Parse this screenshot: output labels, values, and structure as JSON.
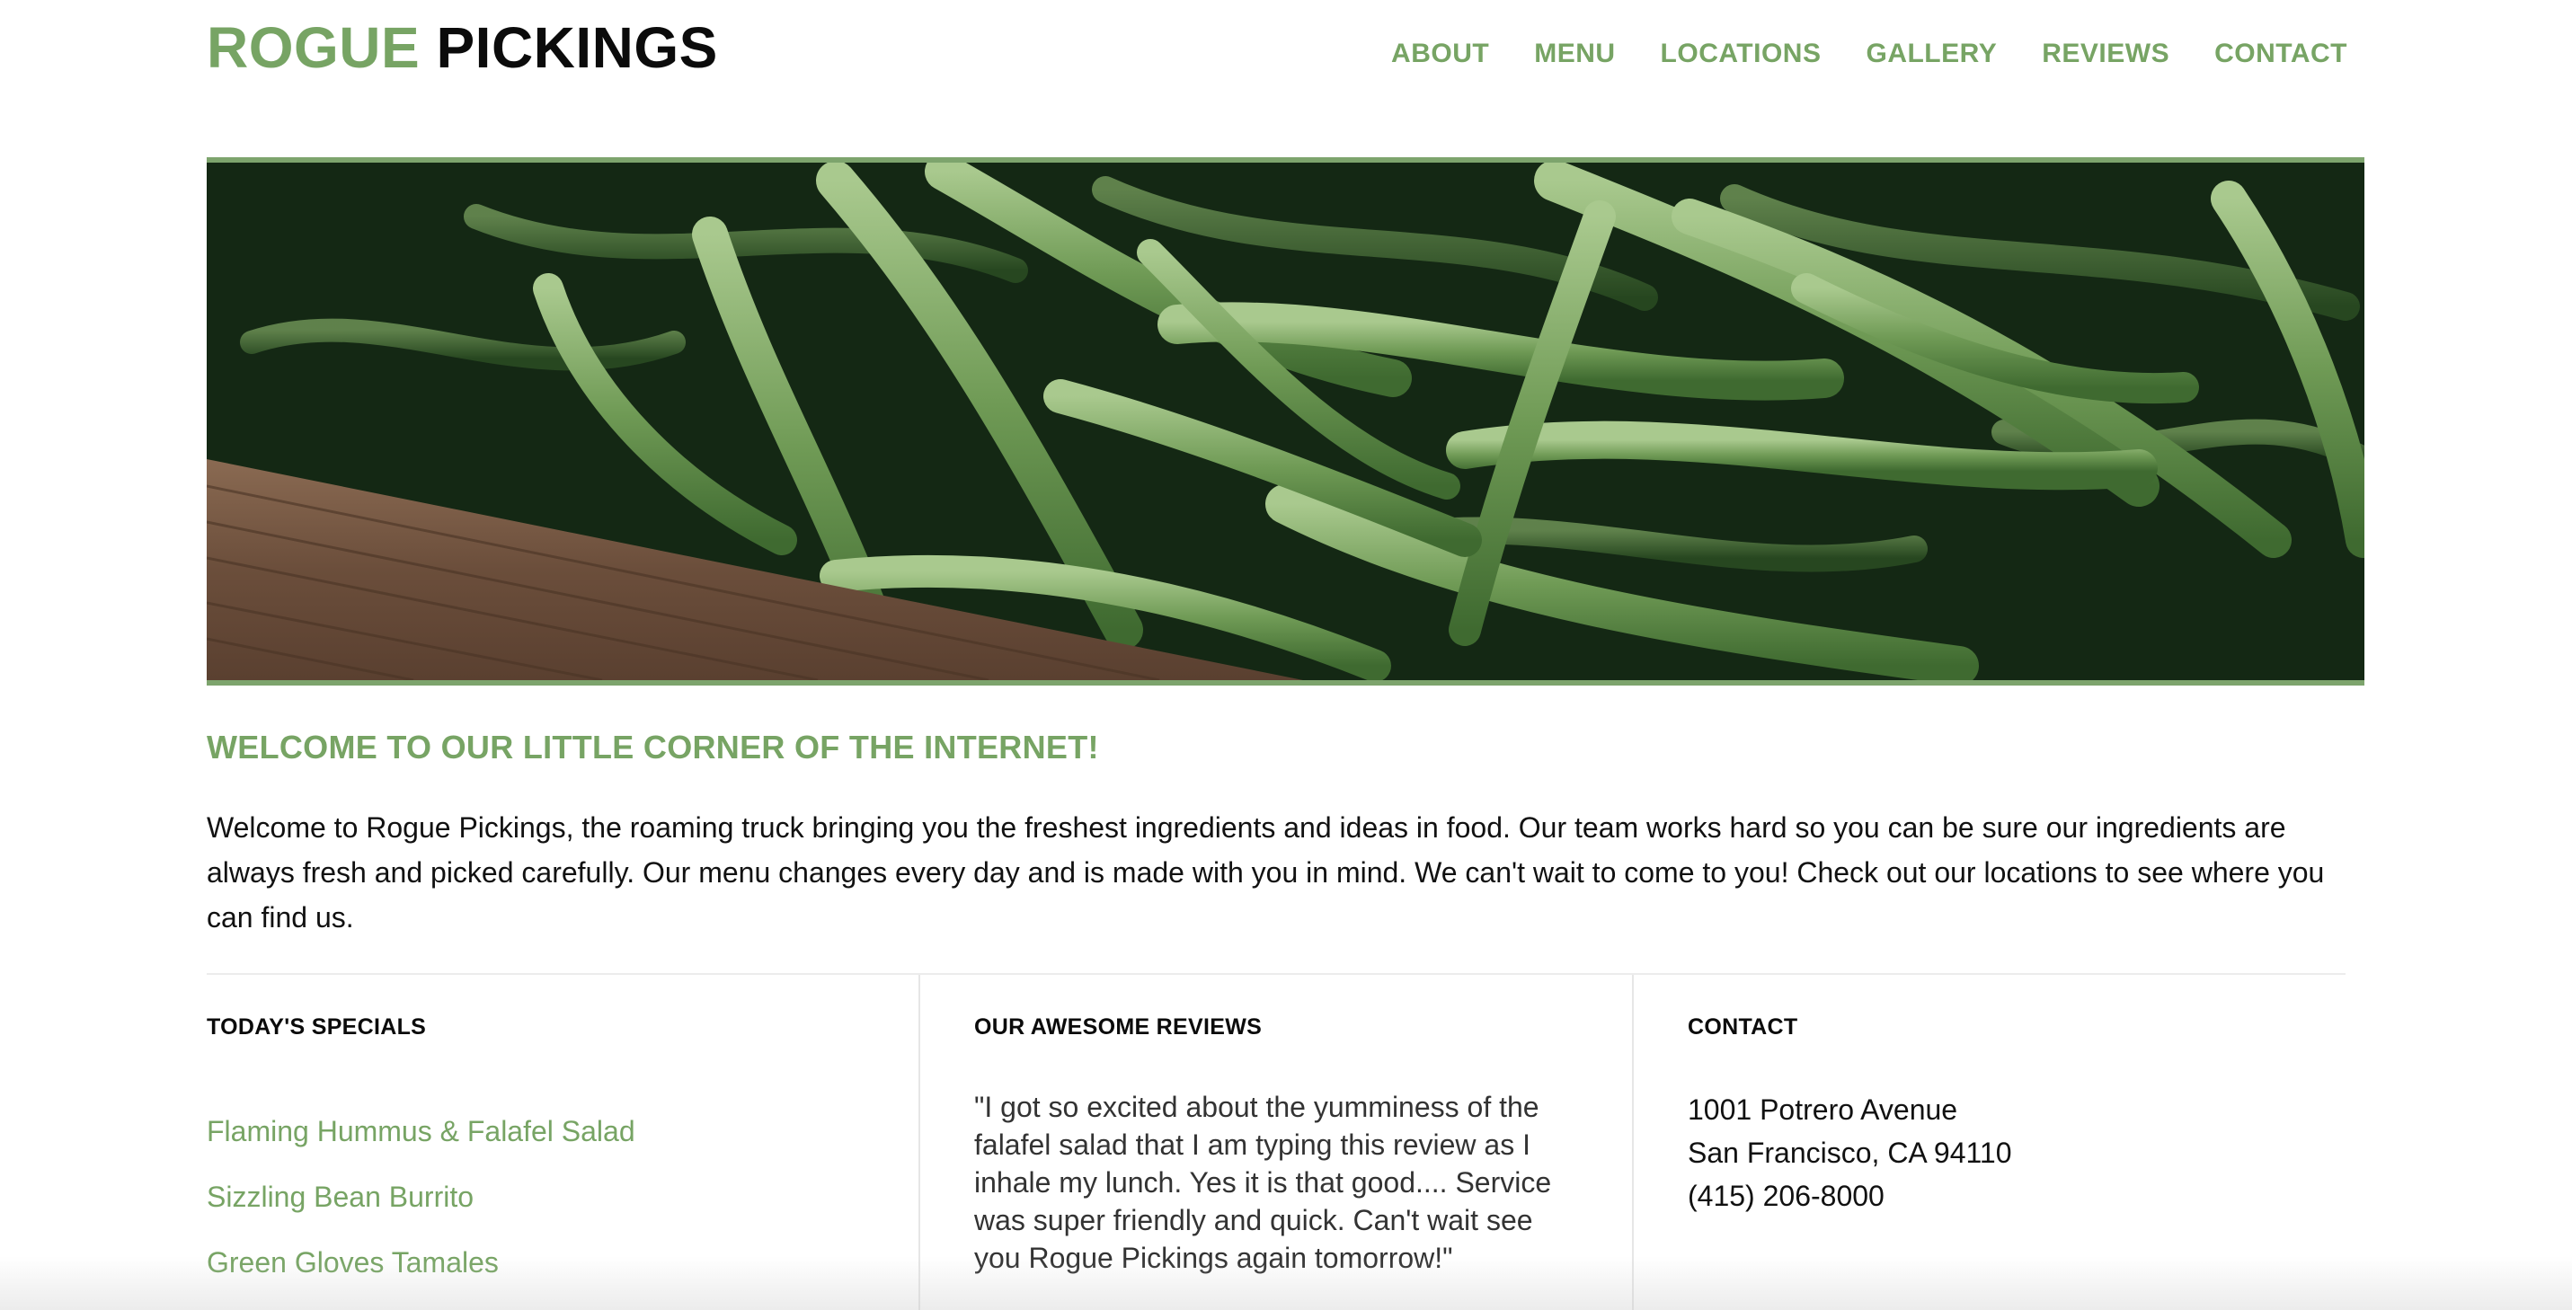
{
  "brand": {
    "first": "ROGUE",
    "second": "PICKINGS",
    "accent_color": "#77a464"
  },
  "nav": {
    "items": [
      {
        "label": "ABOUT"
      },
      {
        "label": "MENU"
      },
      {
        "label": "LOCATIONS"
      },
      {
        "label": "GALLERY"
      },
      {
        "label": "REVIEWS"
      },
      {
        "label": "CONTACT"
      }
    ]
  },
  "hero": {
    "subject": "green beans in a wooden crate",
    "border_color": "#7da46d"
  },
  "welcome": {
    "title": "WELCOME TO OUR LITTLE CORNER OF THE INTERNET!",
    "body": "Welcome to Rogue Pickings, the roaming truck bringing you the freshest ingredients and ideas in food. Our team works hard so you can be sure our ingredients are always fresh and picked carefully. Our menu changes every day and is made with you in mind. We can't wait to come to you! Check out our locations to see where you can find us."
  },
  "specials": {
    "heading": "TODAY'S SPECIALS",
    "items": [
      {
        "label": "Flaming Hummus & Falafel Salad"
      },
      {
        "label": "Sizzling Bean Burrito"
      },
      {
        "label": "Green Gloves Tamales"
      }
    ]
  },
  "reviews": {
    "heading": "OUR AWESOME REVIEWS",
    "quote": "\"I got so excited about the yumminess of the falafel salad that I am typing this review as I inhale my lunch. Yes it is that good.... Service was super friendly and quick. Can't wait see you Rogue Pickings again tomorrow!\""
  },
  "contact": {
    "heading": "CONTACT",
    "address_line1": "1001 Potrero Avenue",
    "address_line2": "San Francisco, CA 94110",
    "phone": "(415) 206-8000"
  }
}
